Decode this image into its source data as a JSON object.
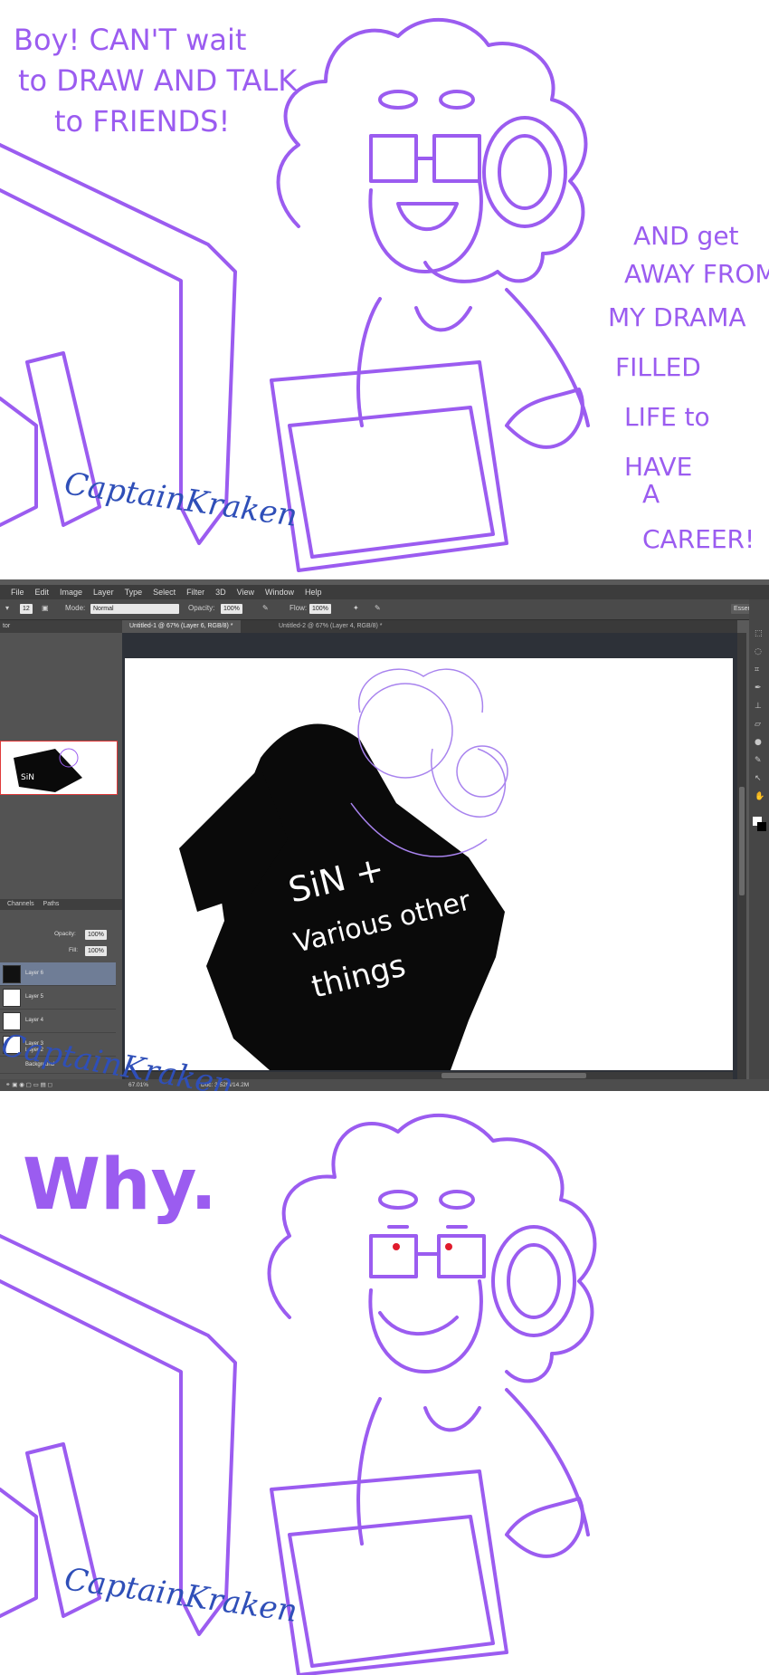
{
  "panel1": {
    "speech_left": [
      "Boy! CAN'T wait",
      "to DRAW AND TALK",
      "to FRIENDS!"
    ],
    "speech_right": [
      "AND get",
      "AWAY FROM",
      "MY DRAMA",
      "FILLED",
      "LIFE to",
      "HAVE",
      "A",
      "CAREER!"
    ],
    "signature": "CaptainKraken"
  },
  "photoshop": {
    "menu": [
      "File",
      "Edit",
      "Image",
      "Layer",
      "Type",
      "Select",
      "Filter",
      "3D",
      "View",
      "Window",
      "Help"
    ],
    "options": {
      "brush_size": "12",
      "mode_label": "Mode:",
      "mode_value": "Normal",
      "opacity_label": "Opacity:",
      "opacity_value": "100%",
      "flow_label": "Flow:",
      "flow_value": "100%",
      "workspace": "Essentials"
    },
    "tabs": [
      {
        "label": "Untitled-1 @ 67% (Layer 6, RGB/8) *",
        "active": true
      },
      {
        "label": "Untitled-2 @ 67% (Layer 4, RGB/8) *",
        "active": false
      }
    ],
    "navigator_title": "tor",
    "layers_panel": {
      "tabs": [
        "Channels",
        "Paths"
      ],
      "opacity_label": "Opacity:",
      "opacity_value": "100%",
      "fill_label": "Fill:",
      "fill_value": "100%",
      "layers": [
        {
          "name": "Layer 6",
          "selected": true
        },
        {
          "name": "Layer 5",
          "selected": false
        },
        {
          "name": "Layer 4",
          "selected": false
        },
        {
          "name": "Layer 3",
          "selected": false
        },
        {
          "name": "Layer 2",
          "selected": false
        },
        {
          "name": "Background",
          "selected": false
        }
      ]
    },
    "status": {
      "zoom": "67.01%",
      "doc": "Doc: 3.52M/14.2M"
    },
    "canvas_text": [
      "SiN +",
      "Various other",
      "things"
    ],
    "nav_thumb_text": "SiN"
  },
  "panel3": {
    "speech": "Why.",
    "signature": "CaptainKraken"
  },
  "colors": {
    "line": "#9b5cf0",
    "signature": "#2f4fb8",
    "eyes": "#e01b2c"
  }
}
